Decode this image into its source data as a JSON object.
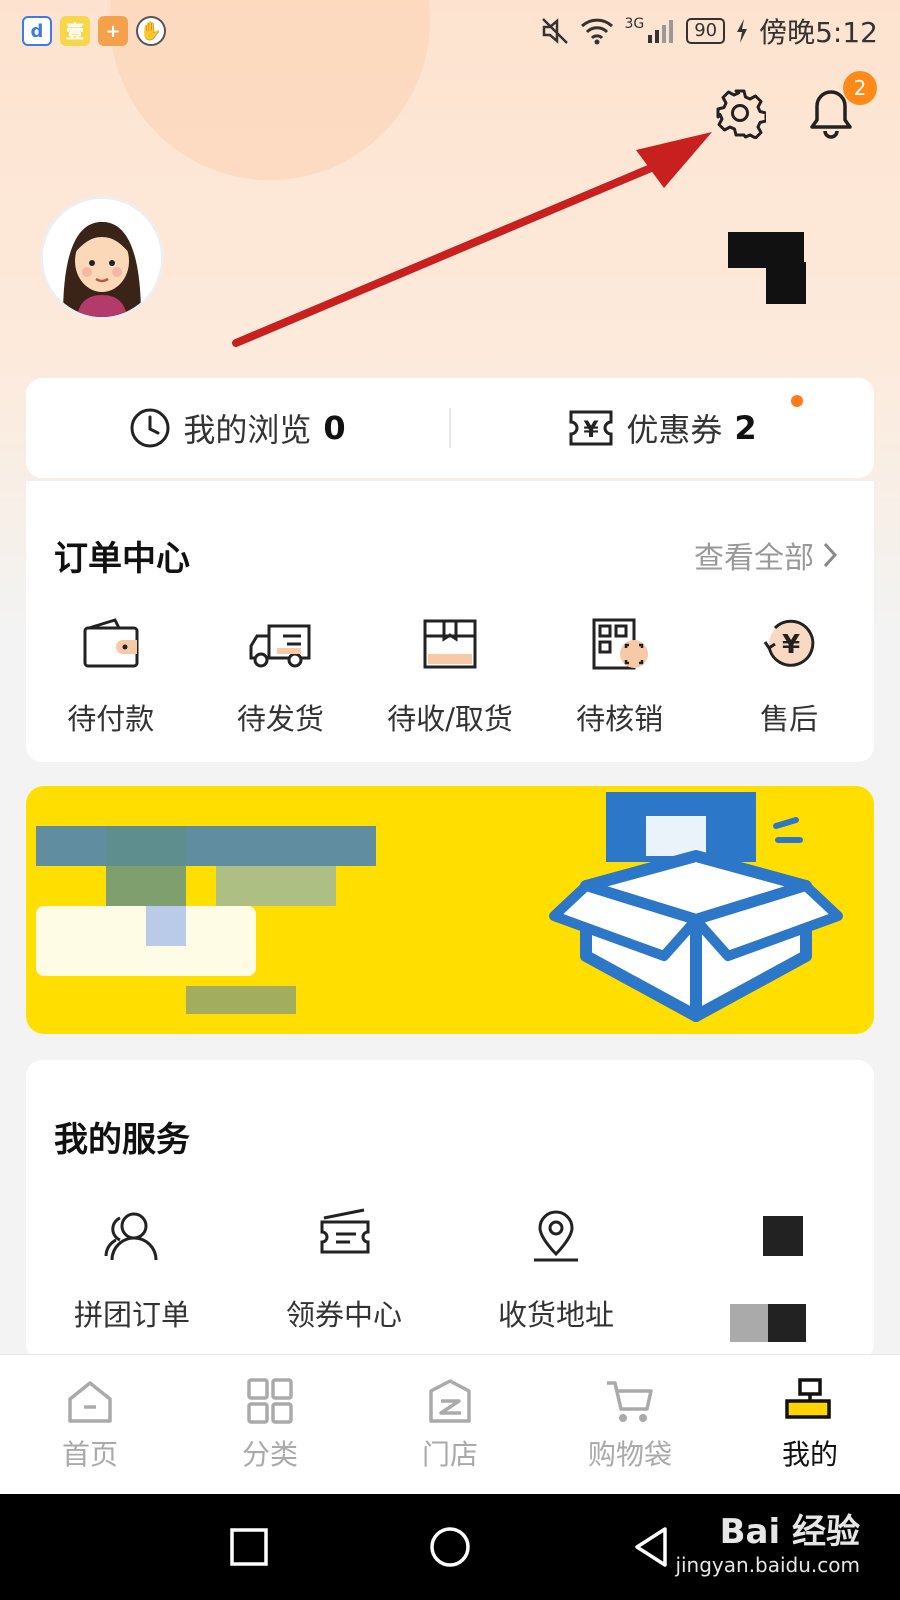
{
  "status_bar": {
    "battery": "90",
    "time": "傍晚5:12",
    "network": "3G",
    "app_icons": [
      "app-1-icon",
      "app-2-icon",
      "app-3-icon",
      "app-4-icon"
    ]
  },
  "header": {
    "notification_count": "2"
  },
  "stats": {
    "browse_label": "我的浏览",
    "browse_count": "0",
    "coupon_label": "优惠券",
    "coupon_count": "2"
  },
  "orders": {
    "title": "订单中心",
    "see_all": "查看全部",
    "items": [
      {
        "label": "待付款",
        "icon": "wallet-icon"
      },
      {
        "label": "待发货",
        "icon": "truck-icon"
      },
      {
        "label": "待收/取货",
        "icon": "package-icon"
      },
      {
        "label": "待核销",
        "icon": "qr-code-icon"
      },
      {
        "label": "售后",
        "icon": "refund-icon"
      }
    ]
  },
  "services": {
    "title": "我的服务",
    "items": [
      {
        "label": "拼团订单",
        "icon": "group-icon"
      },
      {
        "label": "领券中心",
        "icon": "ticket-icon"
      },
      {
        "label": "收货地址",
        "icon": "location-icon"
      }
    ]
  },
  "tabs": [
    {
      "label": "首页",
      "icon": "home-icon"
    },
    {
      "label": "分类",
      "icon": "category-icon"
    },
    {
      "label": "门店",
      "icon": "store-icon"
    },
    {
      "label": "购物袋",
      "icon": "cart-icon"
    },
    {
      "label": "我的",
      "icon": "profile-icon",
      "active": true
    }
  ],
  "watermark": {
    "brand": "Bai 经验",
    "url": "jingyan.baidu.com"
  },
  "colors": {
    "accent_orange": "#ff8a1a",
    "banner_yellow": "#ffde00",
    "annotation_red": "#c8201e",
    "icon_orange": "#f7c9a6"
  }
}
